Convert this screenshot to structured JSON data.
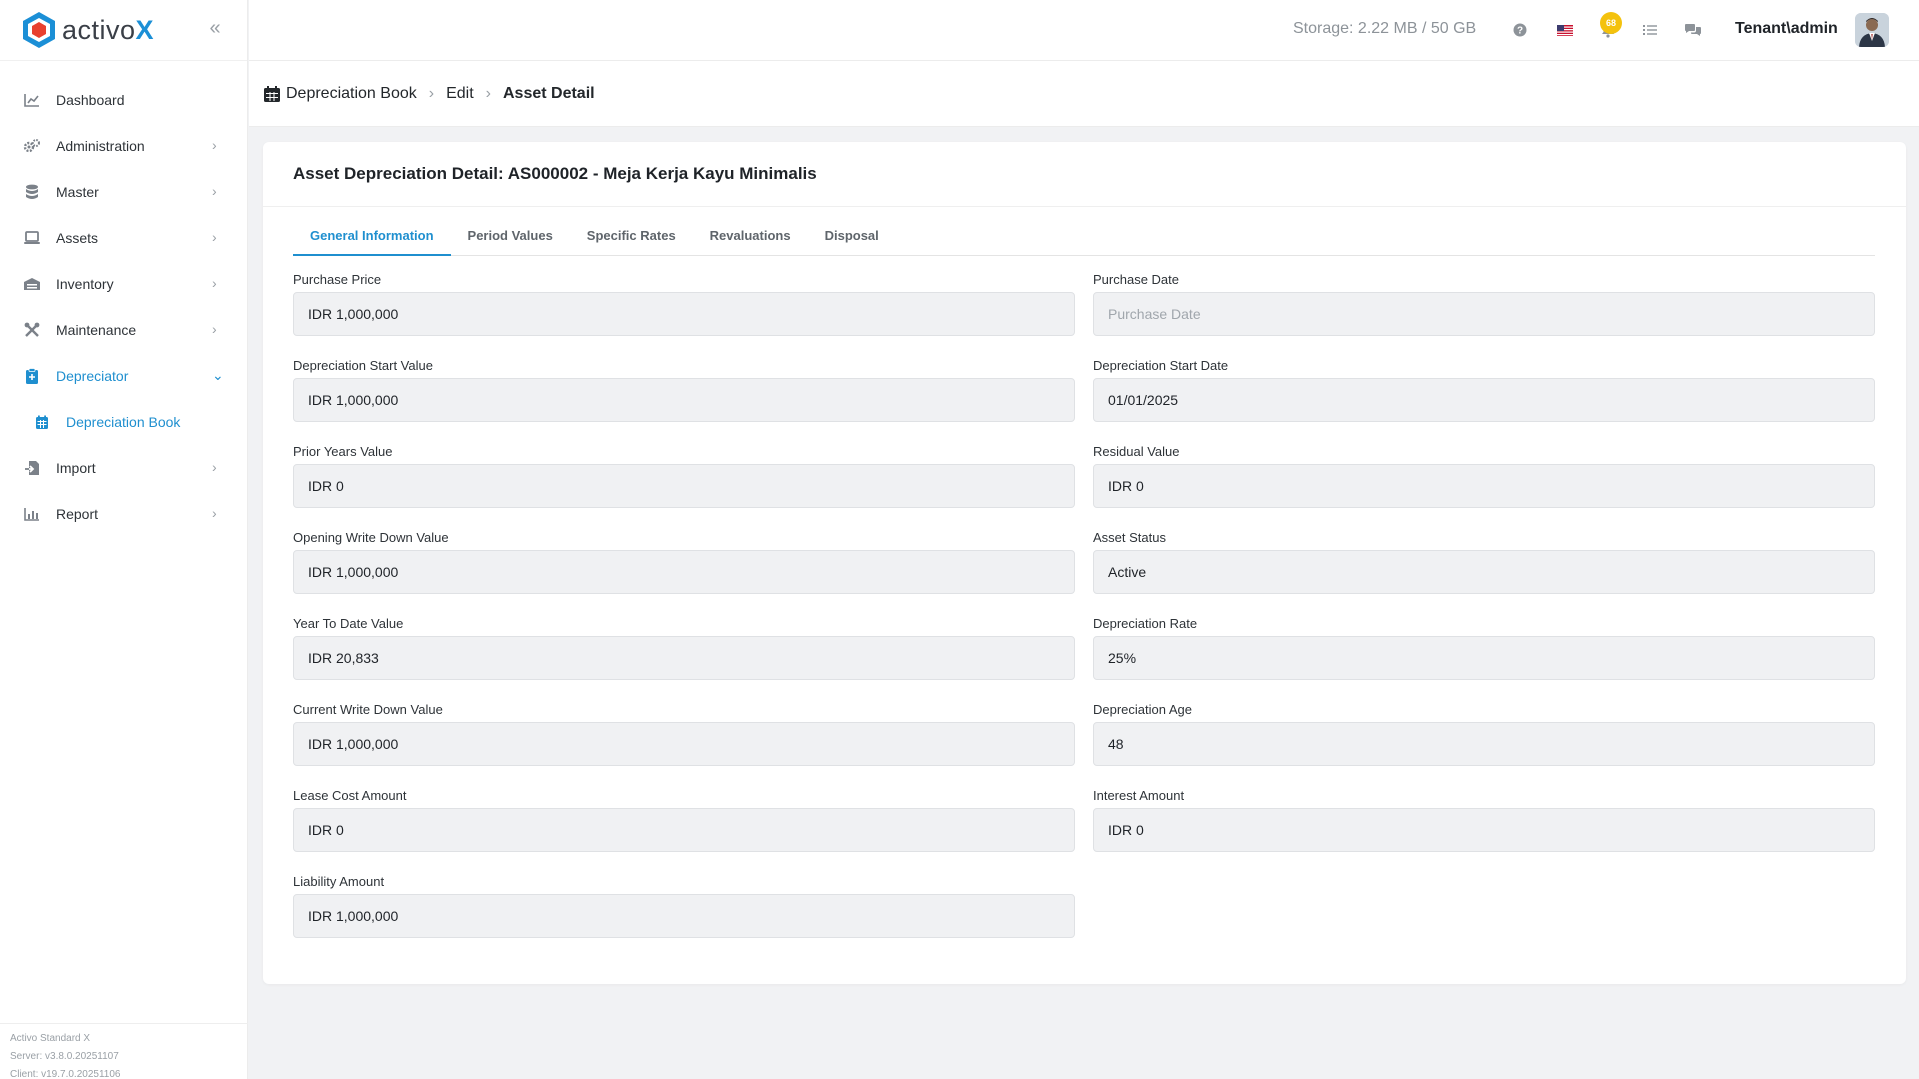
{
  "brand": {
    "name_prefix": "activo",
    "name_suffix": "X"
  },
  "sidebar": {
    "items": [
      {
        "label": "Dashboard",
        "icon": "chart-line-icon"
      },
      {
        "label": "Administration",
        "icon": "gears-icon"
      },
      {
        "label": "Master",
        "icon": "database-icon"
      },
      {
        "label": "Assets",
        "icon": "laptop-icon"
      },
      {
        "label": "Inventory",
        "icon": "warehouse-icon"
      },
      {
        "label": "Maintenance",
        "icon": "tools-icon"
      },
      {
        "label": "Depreciator",
        "icon": "clipboard-icon"
      },
      {
        "label": "Depreciation Book",
        "icon": "calendar-icon"
      },
      {
        "label": "Import",
        "icon": "file-import-icon"
      },
      {
        "label": "Report",
        "icon": "bar-chart-icon"
      }
    ],
    "footer": {
      "product": "Activo Standard X",
      "server": "Server: v3.8.0.20251107",
      "client": "Client: v19.7.0.20251106"
    }
  },
  "topbar": {
    "storage": "Storage: 2.22 MB / 50 GB",
    "notification_count": "68",
    "user": "Tenant\\admin"
  },
  "breadcrumb": {
    "root": "Depreciation Book",
    "middle": "Edit",
    "current": "Asset Detail"
  },
  "card": {
    "title": "Asset Depreciation Detail: AS000002 - Meja Kerja Kayu Minimalis",
    "tabs": [
      "General Information",
      "Period Values",
      "Specific Rates",
      "Revaluations",
      "Disposal"
    ]
  },
  "fields": {
    "purchase_price": {
      "label": "Purchase Price",
      "value": "IDR 1,000,000"
    },
    "purchase_date": {
      "label": "Purchase Date",
      "value": "",
      "placeholder": "Purchase Date"
    },
    "dep_start_value": {
      "label": "Depreciation Start Value",
      "value": "IDR 1,000,000"
    },
    "dep_start_date": {
      "label": "Depreciation Start Date",
      "value": "01/01/2025"
    },
    "prior_years_value": {
      "label": "Prior Years Value",
      "value": "IDR 0"
    },
    "residual_value": {
      "label": "Residual Value",
      "value": "IDR 0"
    },
    "opening_wdv": {
      "label": "Opening Write Down Value",
      "value": "IDR 1,000,000"
    },
    "asset_status": {
      "label": "Asset Status",
      "value": "Active"
    },
    "ytd_value": {
      "label": "Year To Date Value",
      "value": "IDR 20,833"
    },
    "dep_rate": {
      "label": "Depreciation Rate",
      "value": "25%"
    },
    "current_wdv": {
      "label": "Current Write Down Value",
      "value": "IDR 1,000,000"
    },
    "dep_age": {
      "label": "Depreciation Age",
      "value": "48"
    },
    "lease_cost": {
      "label": "Lease Cost Amount",
      "value": "IDR 0"
    },
    "interest": {
      "label": "Interest Amount",
      "value": "IDR 0"
    },
    "liability": {
      "label": "Liability Amount",
      "value": "IDR 1,000,000"
    }
  },
  "colors": {
    "accent": "#1f8fcf",
    "brand_red": "#e8402f",
    "badge": "#f4c20d"
  }
}
